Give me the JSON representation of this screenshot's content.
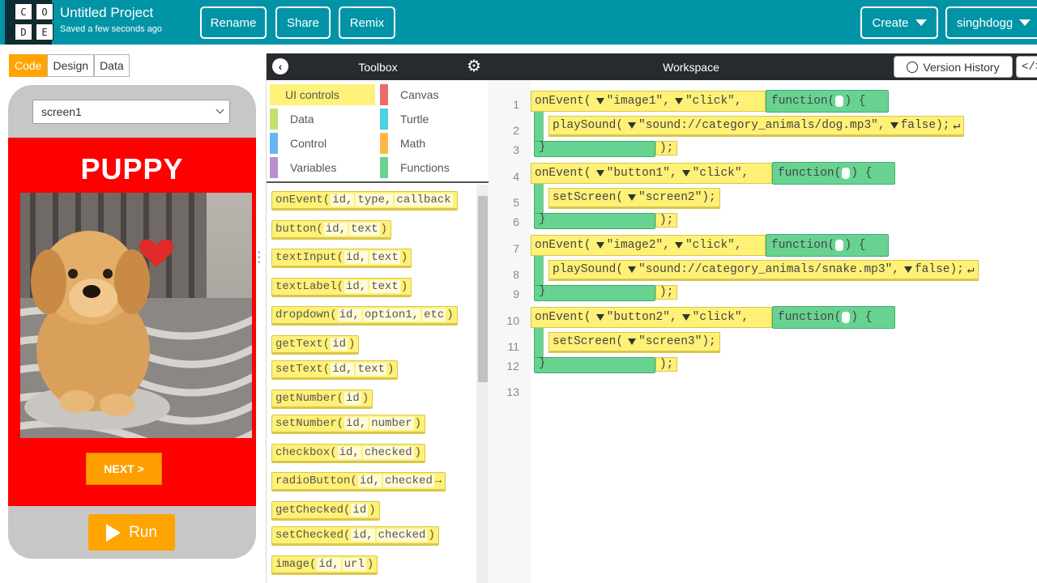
{
  "header": {
    "logo_letters": [
      "C",
      "O",
      "D",
      "E"
    ],
    "project_title": "Untitled Project",
    "saved_status": "Saved a few seconds ago",
    "buttons": {
      "rename": "Rename",
      "share": "Share",
      "remix": "Remix",
      "create": "Create",
      "user": "singhdogg"
    },
    "color": "#0094a6"
  },
  "left_panel": {
    "tabs": {
      "code": "Code",
      "design": "Design",
      "data": "Data"
    },
    "screen_select": "screen1",
    "app": {
      "title": "PUPPY",
      "next_button": "NEXT >",
      "image_desc": "puppy-photo",
      "bg_color": "#ff0000"
    },
    "run_label": "Run"
  },
  "toolbox": {
    "title": "Toolbox",
    "categories": [
      {
        "label": "UI controls",
        "color": "#fff176"
      },
      {
        "label": "Canvas",
        "color": "#f06a6a"
      },
      {
        "label": "Data",
        "color": "#c5e06c"
      },
      {
        "label": "Turtle",
        "color": "#4dd0e1"
      },
      {
        "label": "Control",
        "color": "#64b5f6"
      },
      {
        "label": "Math",
        "color": "#ffb74d"
      },
      {
        "label": "Variables",
        "color": "#ba8fd1"
      },
      {
        "label": "Functions",
        "color": "#68d391"
      }
    ],
    "blocks": [
      {
        "name": "onEvent(",
        "args": [
          "id,",
          "type,",
          "callback"
        ],
        "close": ""
      },
      {
        "name": "button(",
        "args": [
          "id,",
          "text"
        ],
        "close": ")"
      },
      {
        "name": "textInput(",
        "args": [
          "id,",
          "text"
        ],
        "close": ")"
      },
      {
        "name": "textLabel(",
        "args": [
          "id,",
          "text"
        ],
        "close": ")"
      },
      {
        "name": "dropdown(",
        "args": [
          "id,",
          "option1,",
          "etc"
        ],
        "close": ")"
      },
      {
        "name": "getText(",
        "args": [
          "id"
        ],
        "close": ")"
      },
      {
        "name": "setText(",
        "args": [
          "id,",
          "text"
        ],
        "close": ")"
      },
      {
        "name": "getNumber(",
        "args": [
          "id"
        ],
        "close": ")"
      },
      {
        "name": "setNumber(",
        "args": [
          "id,",
          "number"
        ],
        "close": ")"
      },
      {
        "name": "checkbox(",
        "args": [
          "id,",
          "checked"
        ],
        "close": ")"
      },
      {
        "name": "radioButton(",
        "args": [
          "id,",
          "checked"
        ],
        "close": "→"
      },
      {
        "name": "getChecked(",
        "args": [
          "id"
        ],
        "close": ")"
      },
      {
        "name": "setChecked(",
        "args": [
          "id,",
          "checked"
        ],
        "close": ")"
      },
      {
        "name": "image(",
        "args": [
          "id,",
          "url"
        ],
        "close": ")"
      }
    ]
  },
  "workspace": {
    "title": "Workspace",
    "version_history": "Version History",
    "toggle_label": "</>",
    "line_numbers": [
      "1",
      "2",
      "3",
      "4",
      "5",
      "6",
      "7",
      "8",
      "9",
      "10",
      "11",
      "12",
      "13"
    ],
    "events": [
      {
        "head": "onEvent(",
        "id": "\"image1\",",
        "type": "\"click\",",
        "fn": "function(",
        "fn_tail": ") {",
        "call": "playSound(",
        "arg": "\"sound://category_animals/dog.mp3\",",
        "arg2": "false",
        "end": ");",
        "ret": "↵",
        "close": ");"
      },
      {
        "head": "onEvent(",
        "id": "\"button1\",",
        "type": "\"click\",",
        "fn": "function(",
        "fn_tail": ") {",
        "call": "setScreen(",
        "arg": "\"screen2\"",
        "arg2": "",
        "end": ");",
        "ret": "",
        "close": ");"
      },
      {
        "head": "onEvent(",
        "id": "\"image2\",",
        "type": "\"click\",",
        "fn": "function(",
        "fn_tail": ") {",
        "call": "playSound(",
        "arg": "\"sound://category_animals/snake.mp3\",",
        "arg2": "false",
        "end": ");",
        "ret": "↵",
        "close": ");"
      },
      {
        "head": "onEvent(",
        "id": "\"button2\",",
        "type": "\"click\",",
        "fn": "function(",
        "fn_tail": ") {",
        "call": "setScreen(",
        "arg": "\"screen3\"",
        "arg2": "",
        "end": ");",
        "ret": "",
        "close": ");"
      }
    ],
    "brace_close": "}"
  }
}
